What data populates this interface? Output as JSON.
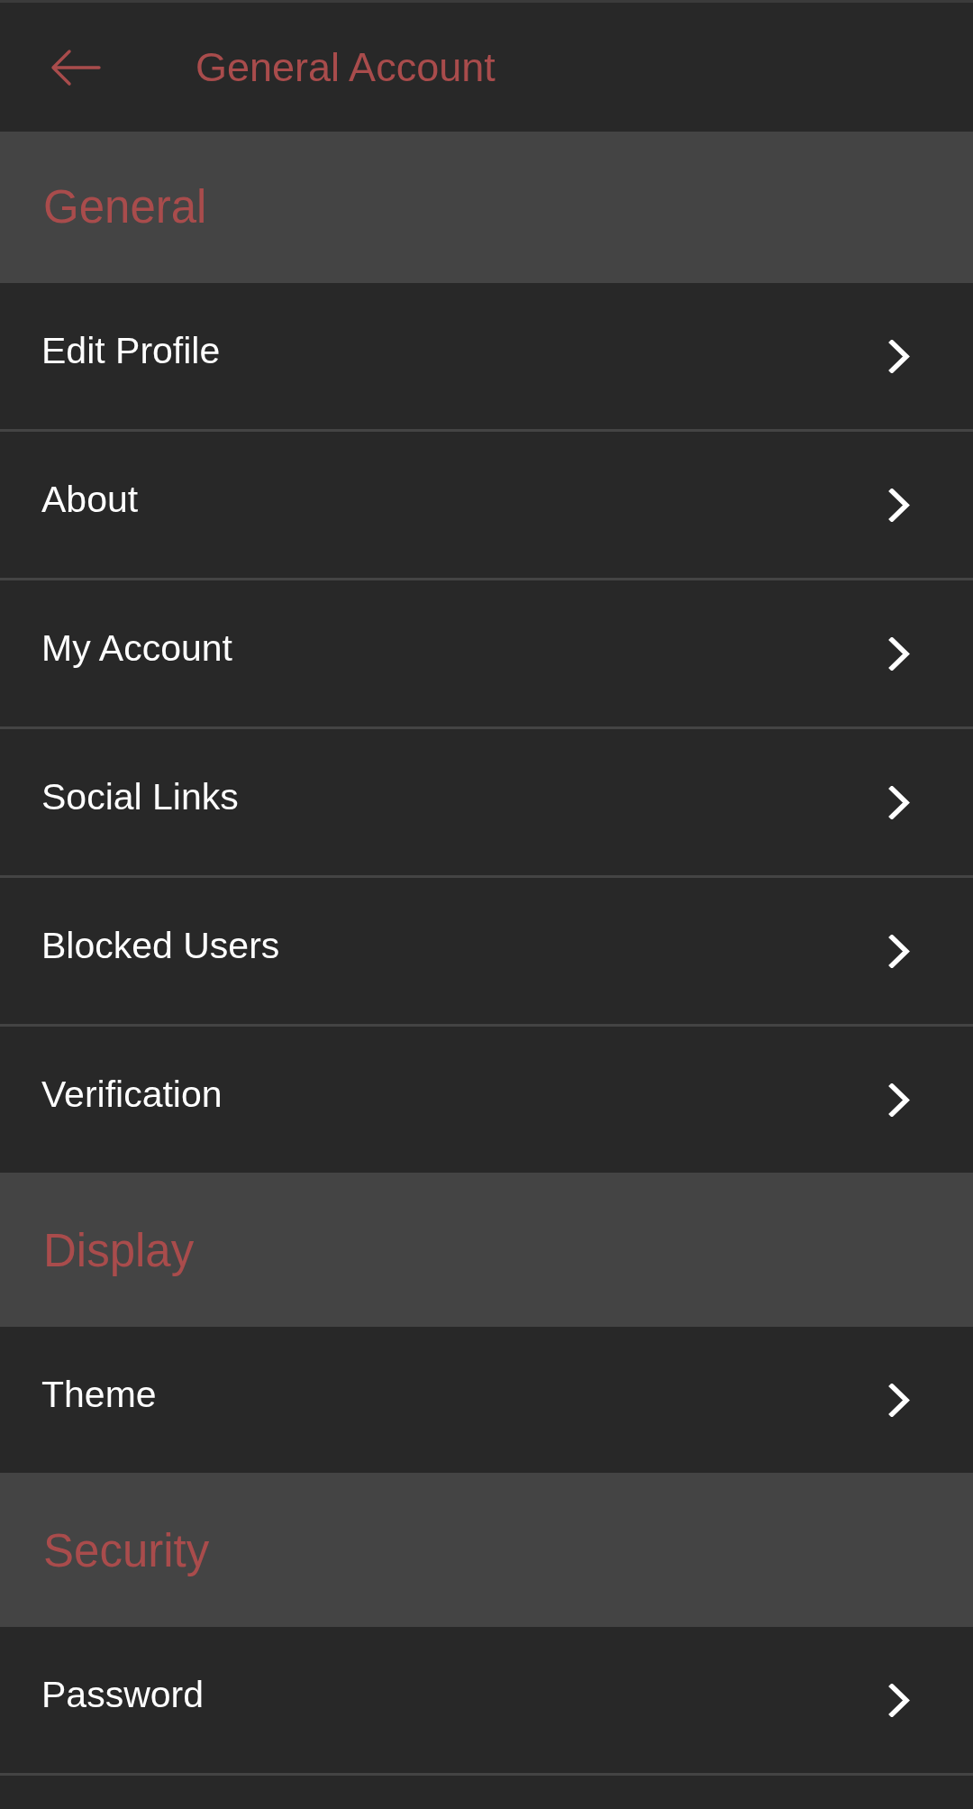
{
  "app_bar": {
    "title": "General Account"
  },
  "sections": [
    {
      "title": "General",
      "items": [
        {
          "label": "Edit Profile"
        },
        {
          "label": "About"
        },
        {
          "label": "My Account"
        },
        {
          "label": "Social Links"
        },
        {
          "label": "Blocked Users"
        },
        {
          "label": "Verification"
        }
      ]
    },
    {
      "title": "Display",
      "items": [
        {
          "label": "Theme"
        }
      ]
    },
    {
      "title": "Security",
      "items": [
        {
          "label": "Password"
        }
      ]
    }
  ]
}
